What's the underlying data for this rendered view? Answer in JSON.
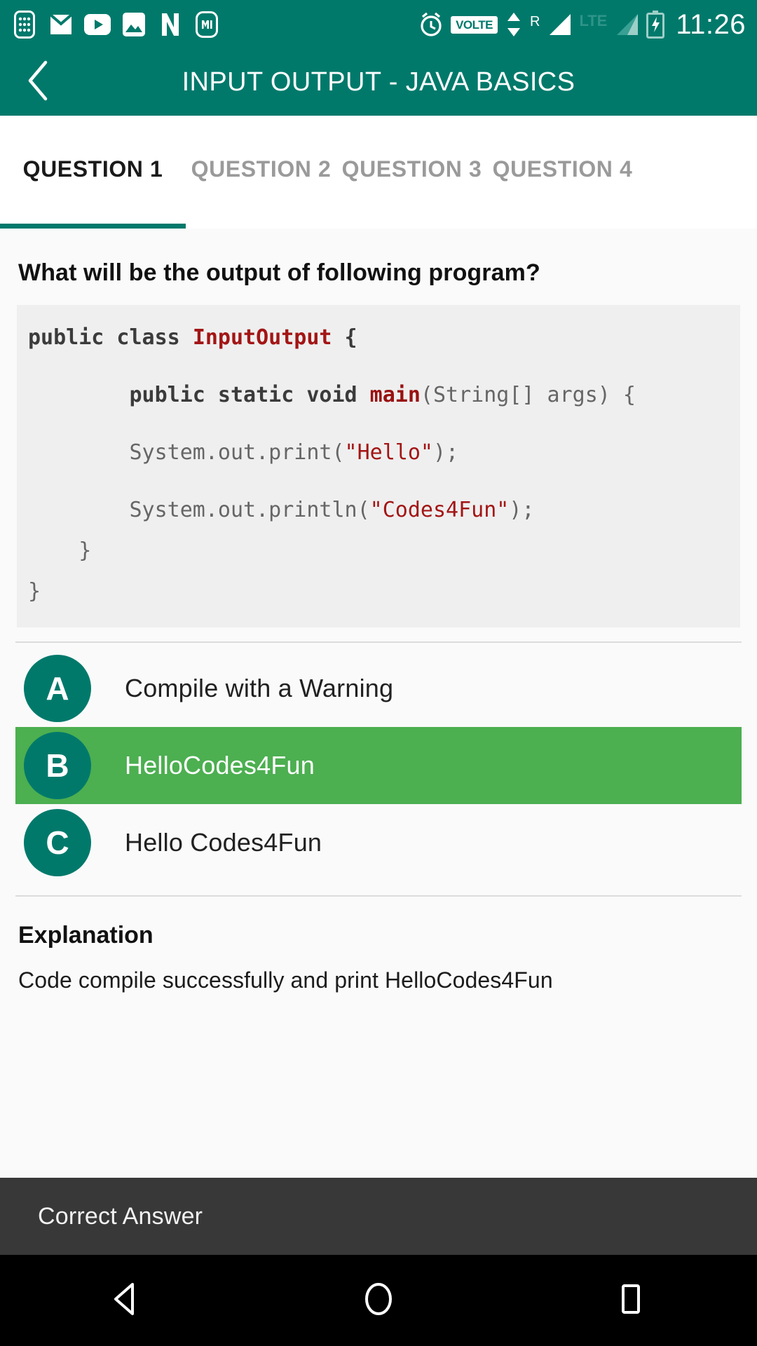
{
  "status_bar": {
    "background": "#00796b",
    "time": "11:26",
    "left_icons": [
      "calculator-icon",
      "gmail-icon",
      "youtube-icon",
      "gallery-icon",
      "netflix-icon",
      "mi-apps-icon"
    ],
    "right_icons": [
      "alarm-icon",
      "volte-icon",
      "data-transfer-icon",
      "roaming-icon",
      "signal-bars-icon",
      "lte-icon",
      "signal-bars-2-icon",
      "battery-charging-icon"
    ],
    "volte_label": "VOLTE",
    "roaming_label": "R",
    "lte_label": "LTE"
  },
  "app_bar": {
    "background": "#00796b",
    "back_icon": "back-chevron-icon",
    "title": "INPUT OUTPUT - JAVA BASICS"
  },
  "tabs": {
    "active_index": 0,
    "indicator_color": "#00796b",
    "items": [
      {
        "label": "QUESTION 1"
      },
      {
        "label": "QUESTION 2"
      },
      {
        "label": "QUESTION 3"
      },
      {
        "label": "QUESTION 4"
      }
    ]
  },
  "question": {
    "title": "What will be the output of following program?",
    "code": {
      "background": "#efefef",
      "lines": [
        {
          "segments": [
            {
              "text": "public class ",
              "style": "kw"
            },
            {
              "text": "InputOutput",
              "style": "cls"
            },
            {
              "text": " {",
              "style": "kw"
            }
          ]
        },
        {
          "segments": []
        },
        {
          "segments": [
            {
              "text": "        public static void ",
              "style": "kw"
            },
            {
              "text": "main",
              "style": "cls2"
            },
            {
              "text": "(String[] args) {",
              "style": "pl"
            }
          ]
        },
        {
          "segments": []
        },
        {
          "segments": [
            {
              "text": "        System.out.print(",
              "style": "pl"
            },
            {
              "text": "\"Hello\"",
              "style": "str"
            },
            {
              "text": ");",
              "style": "pl"
            }
          ]
        },
        {
          "segments": []
        },
        {
          "segments": [
            {
              "text": "        System.out.println(",
              "style": "pl"
            },
            {
              "text": "\"Codes4Fun\"",
              "style": "str"
            },
            {
              "text": ");",
              "style": "pl"
            }
          ]
        },
        {
          "segments": [
            {
              "text": "    }",
              "style": "pl"
            }
          ]
        },
        {
          "segments": [
            {
              "text": "}",
              "style": "pl"
            }
          ]
        }
      ]
    }
  },
  "options": {
    "selected_color": "#4caf50",
    "badge_color": "#00796b",
    "items": [
      {
        "key": "A",
        "label": "Compile with a Warning",
        "selected": false
      },
      {
        "key": "B",
        "label": "HelloCodes4Fun",
        "selected": true
      },
      {
        "key": "C",
        "label": "Hello Codes4Fun",
        "selected": false
      }
    ]
  },
  "explanation": {
    "heading": "Explanation",
    "body": "Code compile successfully and print HelloCodes4Fun"
  },
  "bottom_bar": {
    "background": "#383838",
    "label": "Correct Answer"
  },
  "nav_bar": {
    "background": "#000000",
    "buttons": [
      {
        "icon": "back-triangle-icon"
      },
      {
        "icon": "home-circle-icon"
      },
      {
        "icon": "recents-square-icon"
      }
    ]
  }
}
